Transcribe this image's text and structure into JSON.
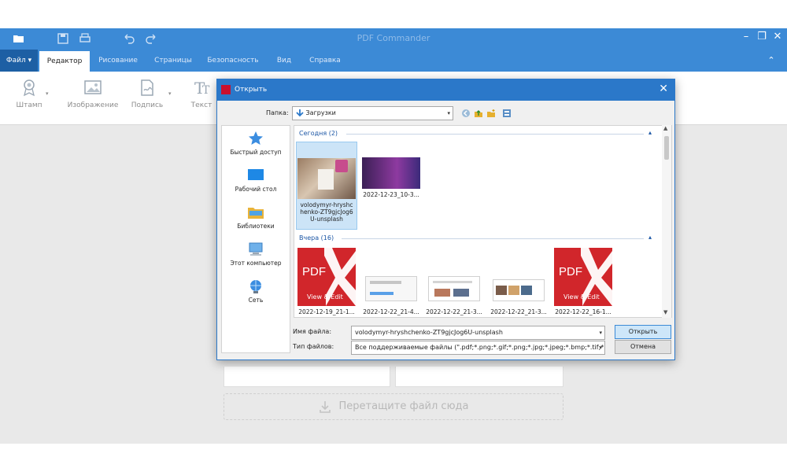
{
  "app": {
    "title": "PDF Commander",
    "menu": [
      "Файл",
      "Редактор",
      "Рисование",
      "Страницы",
      "Безопасность",
      "Вид",
      "Справка"
    ],
    "active_menu": "Редактор",
    "ribbon": [
      {
        "label": "Штамп",
        "icon": "stamp-icon"
      },
      {
        "label": "Изображение",
        "icon": "image-icon"
      },
      {
        "label": "Подпись",
        "icon": "signature-icon"
      },
      {
        "label": "Текст",
        "icon": "text-icon"
      }
    ],
    "dropzone": "Перетащите файл сюда"
  },
  "dialog": {
    "title": "Открыть",
    "folder_label": "Папка:",
    "folder_value": "Загрузки",
    "places": [
      {
        "label": "Быстрый доступ",
        "icon": "star-icon"
      },
      {
        "label": "Рабочий стол",
        "icon": "desktop-icon"
      },
      {
        "label": "Библиотеки",
        "icon": "folder-icon"
      },
      {
        "label": "Этот компьютер",
        "icon": "computer-icon"
      },
      {
        "label": "Сеть",
        "icon": "network-icon"
      }
    ],
    "groups": [
      {
        "header": "Сегодня (2)",
        "files": [
          {
            "name": "volodymyr-hryshchenko-ZT9gjcJog6U-unsplash",
            "selected": true
          },
          {
            "name": "2022-12-23_10-3..."
          }
        ]
      },
      {
        "header": "Вчера (16)",
        "files": [
          {
            "name": "2022-12-19_21-1...",
            "thumb": "pdf"
          },
          {
            "name": "2022-12-22_21-4..."
          },
          {
            "name": "2022-12-22_21-3..."
          },
          {
            "name": "2022-12-22_21-3..."
          },
          {
            "name": "2022-12-22_16-1...",
            "thumb": "pdf"
          }
        ]
      }
    ],
    "pdf_thumb_text": "PDF",
    "pdf_thumb_sub": "View & Edit",
    "filename_label": "Имя файла:",
    "filename_value": "volodymyr-hryshchenko-ZT9gjcJog6U-unsplash",
    "filetype_label": "Тип файлов:",
    "filetype_value": "Все поддерживаемые файлы (\".pdf;*.png;*.gif;*.png;*.jpg;*.jpeg;*.bmp;*.tif;*.tiff;*.t",
    "open_button": "Открыть",
    "cancel_button": "Отмена"
  },
  "colors": {
    "titlebar": "#3c8ad6",
    "dialog_titlebar": "#2b78c9",
    "pdf_red": "#d1262b"
  }
}
